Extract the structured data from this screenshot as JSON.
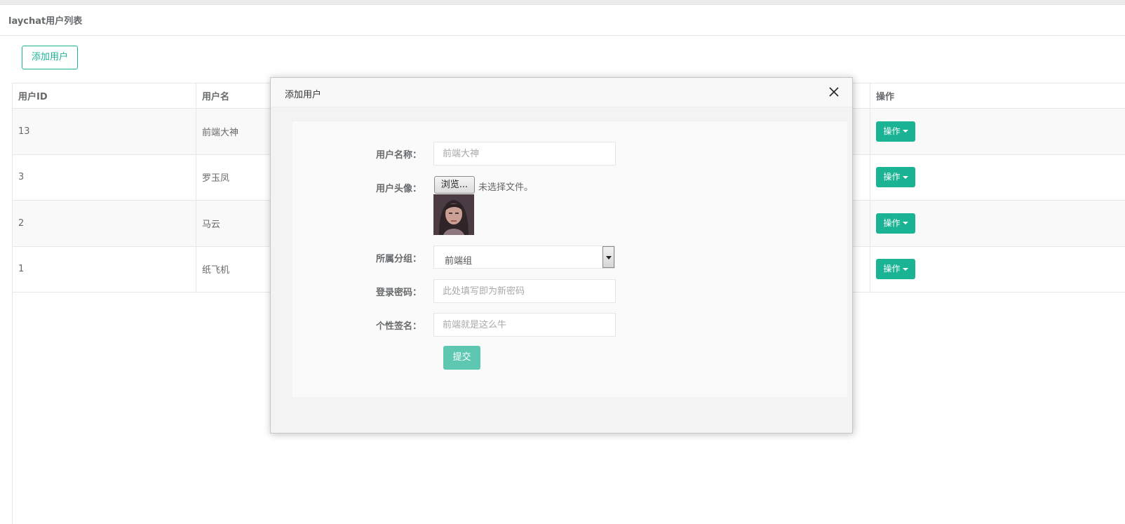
{
  "page": {
    "title": "laychat用户列表",
    "add_button": "添加用户"
  },
  "table": {
    "headers": [
      "用户ID",
      "用户名",
      "操作"
    ],
    "rows": [
      {
        "id": "13",
        "name": "前端大神",
        "op": "操作"
      },
      {
        "id": "3",
        "name": "罗玉凤",
        "op": "操作"
      },
      {
        "id": "2",
        "name": "马云",
        "op": "操作"
      },
      {
        "id": "1",
        "name": "纸飞机",
        "op": "操作"
      }
    ]
  },
  "modal": {
    "title": "添加用户",
    "close_icon": "close-icon",
    "fields": {
      "username_label": "用户名称：",
      "username_placeholder": "前端大神",
      "avatar_label": "用户头像：",
      "file_button": "浏览...",
      "file_status": "未选择文件。",
      "group_label": "所属分组：",
      "group_value": "前端组",
      "password_label": "登录密码：",
      "password_placeholder": "此处填写即为新密码",
      "signature_label": "个性签名：",
      "signature_placeholder": "前端就是这么牛"
    },
    "submit": "提交"
  },
  "colors": {
    "accent": "#1ab394",
    "submit_disabled": "#5dc7b1"
  }
}
